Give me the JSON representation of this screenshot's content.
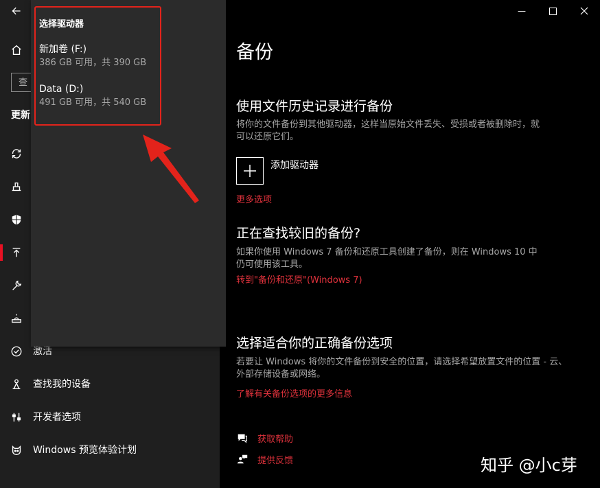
{
  "window": {
    "minimize_glyph": "—",
    "maximize_glyph": "☐",
    "close_glyph": "✕"
  },
  "sidebar": {
    "search_placeholder": "查",
    "section": "更新",
    "items": [
      {
        "label": "激活",
        "icon": "check-circle-icon"
      },
      {
        "label": "查找我的设备",
        "icon": "person-location-icon"
      },
      {
        "label": "开发者选项",
        "icon": "developer-sliders-icon"
      },
      {
        "label": "Windows 预览体验计划",
        "icon": "insider-cat-icon"
      }
    ]
  },
  "flyout": {
    "title": "选择驱动器",
    "drives": [
      {
        "name": "新加卷 (F:)",
        "size": "386 GB 可用，共 390 GB"
      },
      {
        "name": "Data (D:)",
        "size": "491 GB 可用，共 540 GB"
      }
    ]
  },
  "main": {
    "title": "备份",
    "file_history": {
      "heading": "使用文件历史记录进行备份",
      "description": "将你的文件备份到其他驱动器，这样当原始文件丢失、受损或者被删除时，就可以还原它们。",
      "add_drive_label": "添加驱动器",
      "more_options": "更多选项"
    },
    "older_backup": {
      "heading": "正在查找较旧的备份?",
      "description": "如果你使用 Windows 7 备份和还原工具创建了备份，则在 Windows 10 中仍可使用该工具。",
      "link": "转到\"备份和还原\"(Windows 7)"
    },
    "choose_option": {
      "heading": "选择适合你的正确备份选项",
      "description": "若要让 Windows 将你的文件备份到安全的位置，请选择希望放置文件的位置 - 云、外部存储设备或网络。",
      "link": "了解有关备份选项的更多信息"
    },
    "help": {
      "get_help": "获取帮助",
      "feedback": "提供反馈"
    }
  },
  "watermark": "知乎 @小c芽",
  "colors": {
    "accent": "#e0323c",
    "annotation_red": "#e3231b",
    "sidebar_bg": "#1f1f1f",
    "flyout_bg": "#2b2b2b"
  }
}
